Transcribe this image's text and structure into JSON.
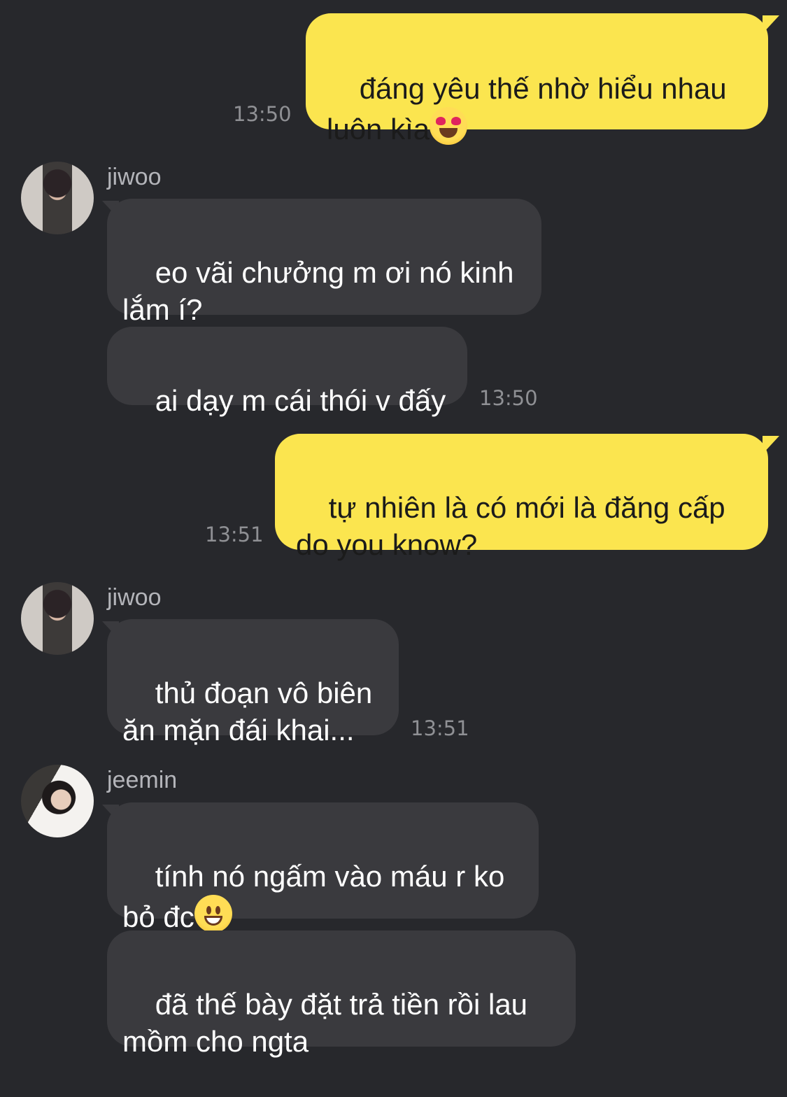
{
  "messages": {
    "m1": {
      "text": "đáng yêu thế nhờ hiểu nhau\nluôn kìa",
      "time": "13:50",
      "emoji": "heart-eyes-emoji"
    },
    "jiwoo_name_1": "jiwoo",
    "m2": {
      "text": "eo vãi chưởng m ơi nó kinh\nlắm í?"
    },
    "m3": {
      "text": "ai dạy m cái thói v đấy",
      "time": "13:50"
    },
    "m4": {
      "text": "tự nhiên là có mới là đăng cấp\ndo you know?",
      "time": "13:51"
    },
    "jiwoo_name_2": "jiwoo",
    "m5": {
      "text": "thủ đoạn vô biên\năn mặn đái khai...",
      "time": "13:51"
    },
    "jeemin_name": "jeemin",
    "m6": {
      "text": "tính nó ngấm vào máu r ko\nbỏ đc",
      "emoji": "grinning-emoji"
    },
    "m7": {
      "text": "đã thế bày đặt trả tiền rồi lau\nmồm cho ngta"
    }
  },
  "colors": {
    "background": "#27282c",
    "outgoing_bubble": "#fbe54f",
    "incoming_bubble": "#3a3a3e",
    "timestamp": "#8f9094",
    "sender_name": "#b4b5ba"
  }
}
